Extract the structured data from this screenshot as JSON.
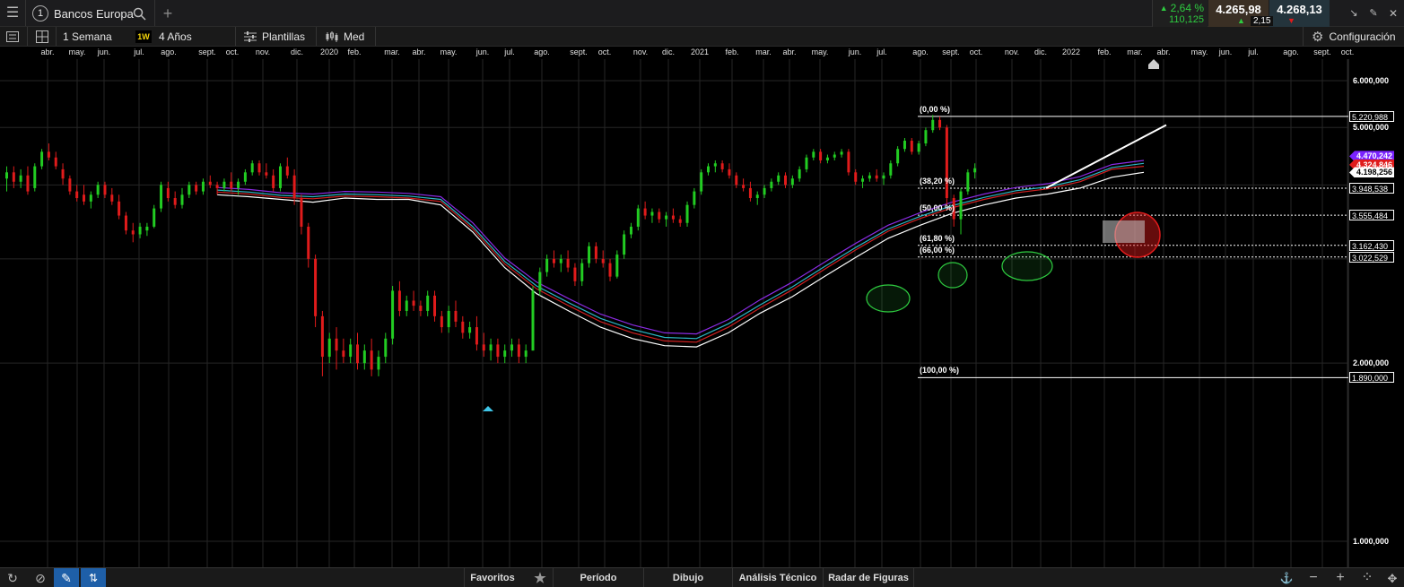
{
  "topbar": {
    "menu_icon": "hamburger-icon",
    "instrument_number": "1",
    "instrument_name": "Bancos Europa",
    "change_pct": "2,64 %",
    "change_abs": "110,125",
    "bid": "4.265,98",
    "bid_change": "2,15",
    "ask": "4.268,13"
  },
  "toolbar": {
    "period": "1 Semana",
    "interval_badge": "1W",
    "range": "4 Años",
    "templates": "Plantillas",
    "price_type": "Med",
    "settings": "Configuración"
  },
  "bottombar": {
    "favorites": "Favoritos",
    "period": "Período",
    "drawing": "Dibujo",
    "technical": "Análisis Técnico",
    "patterns": "Radar de Figuras"
  },
  "colors": {
    "up": "#22cc22",
    "down": "#e01b1b",
    "ema_white": "#ffffff",
    "ema_purple": "#8a2be2",
    "ema_cyan": "#2bb7c4",
    "ema_red": "#d02020",
    "accent_green": "#2ecc40"
  },
  "chart_data": {
    "type": "candlestick",
    "scale": "log",
    "months": [
      {
        "label": "abr."
      },
      {
        "label": "may."
      },
      {
        "label": "jun."
      },
      {
        "label": "jul."
      },
      {
        "label": "ago."
      },
      {
        "label": "sept."
      },
      {
        "label": "oct."
      },
      {
        "label": "nov."
      },
      {
        "label": "dic."
      },
      {
        "label": "2020"
      },
      {
        "label": "feb."
      },
      {
        "label": "mar."
      },
      {
        "label": "abr."
      },
      {
        "label": "may."
      },
      {
        "label": "jun."
      },
      {
        "label": "jul."
      },
      {
        "label": "ago."
      },
      {
        "label": "sept."
      },
      {
        "label": "oct."
      },
      {
        "label": "nov."
      },
      {
        "label": "dic."
      },
      {
        "label": "2021"
      },
      {
        "label": "feb."
      },
      {
        "label": "mar."
      },
      {
        "label": "abr."
      },
      {
        "label": "may."
      },
      {
        "label": "jun."
      },
      {
        "label": "jul."
      },
      {
        "label": "ago."
      },
      {
        "label": "sept."
      },
      {
        "label": "oct."
      },
      {
        "label": "nov."
      },
      {
        "label": "dic."
      },
      {
        "label": "2022"
      },
      {
        "label": "feb."
      },
      {
        "label": "mar."
      },
      {
        "label": "abr."
      },
      {
        "label": "may."
      },
      {
        "label": "jun."
      },
      {
        "label": "jul."
      },
      {
        "label": "ago."
      },
      {
        "label": "sept."
      },
      {
        "label": "oct."
      }
    ],
    "y_axis_labels": [
      {
        "label": "6.000,000",
        "value": 6000
      },
      {
        "label": "5.000,000",
        "value": 5000
      },
      {
        "label": "2.000,000",
        "value": 2000
      },
      {
        "label": "1.000,000",
        "value": 1000
      }
    ],
    "fibonacci": [
      {
        "label": "(0,00 %)",
        "price": "5.220,988",
        "value": 5220.988
      },
      {
        "label": "(38,20 %)",
        "price": "3.948,538",
        "value": 3948.538
      },
      {
        "label": "(50,00 %)",
        "price": "3.555,484",
        "value": 3555.484
      },
      {
        "label": "(61,80 %)",
        "price": "3.162,430",
        "value": 3162.43
      },
      {
        "label": "(66,00 %)",
        "price": "3.022,529",
        "value": 3022.529
      },
      {
        "label": "(100,00 %)",
        "price": "1.890,000",
        "value": 1890
      }
    ],
    "price_tags": [
      {
        "price": "4.470,242",
        "value": 4470.242,
        "color": "#7a22ff",
        "text_color": "#ffffff"
      },
      {
        "price": "4.324,846",
        "value": 4324.846,
        "color": "#e01b1b",
        "text_color": "#ffffff"
      },
      {
        "price": "4.198,256",
        "value": 4198.256,
        "color": "#ffffff",
        "text_color": "#000000"
      }
    ],
    "candles": [
      [
        4100,
        4300,
        3900,
        4200
      ],
      [
        4200,
        4300,
        3950,
        4050
      ],
      [
        4050,
        4250,
        3950,
        4150
      ],
      [
        4150,
        4300,
        3850,
        3900
      ],
      [
        3950,
        4350,
        3900,
        4300
      ],
      [
        4300,
        4600,
        4250,
        4550
      ],
      [
        4550,
        4700,
        4400,
        4450
      ],
      [
        4450,
        4550,
        4250,
        4300
      ],
      [
        4250,
        4350,
        4000,
        4100
      ],
      [
        4100,
        4150,
        3850,
        3900
      ],
      [
        3900,
        4000,
        3750,
        3800
      ],
      [
        3850,
        4000,
        3700,
        3750
      ],
      [
        3750,
        3900,
        3650,
        3850
      ],
      [
        3850,
        4050,
        3800,
        4000
      ],
      [
        4000,
        4050,
        3800,
        3850
      ],
      [
        3850,
        3950,
        3700,
        3750
      ],
      [
        3750,
        3850,
        3500,
        3550
      ],
      [
        3550,
        3600,
        3300,
        3350
      ],
      [
        3350,
        3450,
        3200,
        3300
      ],
      [
        3300,
        3450,
        3250,
        3400
      ],
      [
        3350,
        3450,
        3280,
        3400
      ],
      [
        3400,
        3700,
        3380,
        3650
      ],
      [
        3650,
        4050,
        3600,
        4000
      ],
      [
        3950,
        4050,
        3750,
        3800
      ],
      [
        3800,
        3900,
        3650,
        3700
      ],
      [
        3700,
        3950,
        3650,
        3850
      ],
      [
        3850,
        4050,
        3800,
        4000
      ],
      [
        4000,
        4050,
        3850,
        3900
      ],
      [
        3900,
        4100,
        3850,
        4050
      ],
      [
        4050,
        4150,
        3950,
        4000
      ],
      [
        4000,
        4050,
        3850,
        3950
      ],
      [
        3950,
        4100,
        3900,
        4050
      ],
      [
        4050,
        4200,
        3900,
        3950
      ],
      [
        3950,
        4100,
        3850,
        4050
      ],
      [
        4050,
        4250,
        4000,
        4200
      ],
      [
        4200,
        4400,
        4150,
        4350
      ],
      [
        4350,
        4400,
        4150,
        4200
      ],
      [
        4200,
        4350,
        4100,
        4150
      ],
      [
        4150,
        4250,
        3900,
        3950
      ],
      [
        3950,
        4350,
        3900,
        4300
      ],
      [
        4300,
        4450,
        4100,
        4150
      ],
      [
        4150,
        4250,
        3700,
        3800
      ],
      [
        3800,
        3850,
        3300,
        3400
      ],
      [
        3400,
        3450,
        2900,
        3000
      ],
      [
        3000,
        3050,
        2300,
        2400
      ],
      [
        2400,
        2450,
        1900,
        2050
      ],
      [
        2050,
        2250,
        2000,
        2200
      ],
      [
        2200,
        2300,
        1950,
        2100
      ],
      [
        2100,
        2200,
        2000,
        2050
      ],
      [
        2050,
        2200,
        2000,
        2150
      ],
      [
        2150,
        2250,
        1950,
        2000
      ],
      [
        2000,
        2150,
        1950,
        2100
      ],
      [
        2100,
        2200,
        1900,
        1950
      ],
      [
        1950,
        2100,
        1900,
        2050
      ],
      [
        2050,
        2250,
        2000,
        2200
      ],
      [
        2200,
        2700,
        2150,
        2650
      ],
      [
        2650,
        2750,
        2400,
        2450
      ],
      [
        2450,
        2600,
        2400,
        2550
      ],
      [
        2550,
        2650,
        2450,
        2500
      ],
      [
        2500,
        2550,
        2400,
        2450
      ],
      [
        2450,
        2650,
        2400,
        2600
      ],
      [
        2600,
        2650,
        2350,
        2400
      ],
      [
        2400,
        2450,
        2250,
        2300
      ],
      [
        2300,
        2500,
        2250,
        2450
      ],
      [
        2450,
        2550,
        2300,
        2350
      ],
      [
        2350,
        2400,
        2200,
        2250
      ],
      [
        2250,
        2350,
        2200,
        2300
      ],
      [
        2300,
        2400,
        2100,
        2150
      ],
      [
        2150,
        2250,
        2050,
        2100
      ],
      [
        2100,
        2200,
        2020,
        2150
      ],
      [
        2150,
        2200,
        2000,
        2050
      ],
      [
        2050,
        2150,
        2000,
        2100
      ],
      [
        2100,
        2200,
        2050,
        2150
      ],
      [
        2150,
        2200,
        2000,
        2050
      ],
      [
        2050,
        2150,
        2000,
        2100
      ],
      [
        2100,
        2700,
        2100,
        2650
      ],
      [
        2650,
        2900,
        2600,
        2850
      ],
      [
        2850,
        3050,
        2800,
        3000
      ],
      [
        3000,
        3100,
        2900,
        2950
      ],
      [
        2950,
        3050,
        2850,
        3000
      ],
      [
        3000,
        3100,
        2850,
        2900
      ],
      [
        2900,
        2950,
        2700,
        2750
      ],
      [
        2750,
        3000,
        2700,
        2950
      ],
      [
        2950,
        3200,
        2900,
        3150
      ],
      [
        3150,
        3200,
        2950,
        3000
      ],
      [
        3000,
        3100,
        2900,
        2950
      ],
      [
        2950,
        3000,
        2750,
        2800
      ],
      [
        2800,
        3100,
        2780,
        3050
      ],
      [
        3050,
        3350,
        3000,
        3300
      ],
      [
        3300,
        3450,
        3250,
        3400
      ],
      [
        3400,
        3700,
        3350,
        3650
      ],
      [
        3650,
        3750,
        3500,
        3550
      ],
      [
        3550,
        3650,
        3450,
        3600
      ],
      [
        3600,
        3650,
        3450,
        3500
      ],
      [
        3500,
        3600,
        3400,
        3550
      ],
      [
        3550,
        3650,
        3450,
        3500
      ],
      [
        3500,
        3550,
        3400,
        3450
      ],
      [
        3450,
        3750,
        3400,
        3700
      ],
      [
        3700,
        3950,
        3650,
        3900
      ],
      [
        3900,
        4250,
        3850,
        4200
      ],
      [
        4200,
        4350,
        4150,
        4300
      ],
      [
        4300,
        4400,
        4200,
        4350
      ],
      [
        4350,
        4400,
        4200,
        4250
      ],
      [
        4250,
        4350,
        4100,
        4150
      ],
      [
        4150,
        4200,
        3950,
        4000
      ],
      [
        4000,
        4100,
        3900,
        3950
      ],
      [
        3950,
        4050,
        3750,
        3800
      ],
      [
        3800,
        3900,
        3700,
        3850
      ],
      [
        3850,
        4000,
        3800,
        3950
      ],
      [
        3950,
        4100,
        3900,
        4050
      ],
      [
        4050,
        4200,
        4000,
        4150
      ],
      [
        4150,
        4200,
        3950,
        4000
      ],
      [
        4000,
        4150,
        3950,
        4100
      ],
      [
        4100,
        4300,
        4050,
        4250
      ],
      [
        4250,
        4500,
        4200,
        4450
      ],
      [
        4450,
        4600,
        4400,
        4550
      ],
      [
        4550,
        4600,
        4350,
        4400
      ],
      [
        4400,
        4500,
        4350,
        4450
      ],
      [
        4450,
        4550,
        4400,
        4500
      ],
      [
        4500,
        4600,
        4450,
        4550
      ],
      [
        4550,
        4600,
        4150,
        4200
      ],
      [
        4200,
        4250,
        4000,
        4050
      ],
      [
        4050,
        4150,
        3950,
        4100
      ],
      [
        4100,
        4200,
        4050,
        4150
      ],
      [
        4150,
        4250,
        4050,
        4100
      ],
      [
        4100,
        4200,
        4000,
        4150
      ],
      [
        4150,
        4400,
        4100,
        4350
      ],
      [
        4350,
        4650,
        4300,
        4600
      ],
      [
        4600,
        4800,
        4550,
        4750
      ],
      [
        4750,
        4800,
        4500,
        4550
      ],
      [
        4550,
        4750,
        4500,
        4700
      ],
      [
        4700,
        5000,
        4650,
        4950
      ],
      [
        4950,
        5250,
        4900,
        5150
      ],
      [
        5150,
        5221,
        4950,
        5000
      ],
      [
        5000,
        5050,
        3700,
        3800
      ],
      [
        3800,
        3850,
        3400,
        3500
      ],
      [
        3500,
        3950,
        3300,
        3900
      ],
      [
        3900,
        4250,
        3850,
        4200
      ],
      [
        4200,
        4350,
        4100,
        4268
      ]
    ],
    "ema": {
      "white": [
        3850,
        3820,
        3780,
        3740,
        3800,
        3780,
        3780,
        3700,
        3330,
        2900,
        2620,
        2450,
        2300,
        2200,
        2140,
        2130,
        2250,
        2430,
        2590,
        2800,
        3020,
        3250,
        3420,
        3580,
        3700,
        3800,
        3860,
        3950,
        4120,
        4200
      ],
      "purple": [
        3960,
        3930,
        3880,
        3860,
        3900,
        3890,
        3870,
        3820,
        3450,
        3010,
        2740,
        2570,
        2420,
        2320,
        2250,
        2240,
        2370,
        2560,
        2740,
        2960,
        3190,
        3420,
        3590,
        3740,
        3860,
        3960,
        4020,
        4130,
        4330,
        4400
      ],
      "cyan": [
        3920,
        3890,
        3840,
        3820,
        3860,
        3850,
        3830,
        3780,
        3400,
        2970,
        2700,
        2530,
        2380,
        2280,
        2210,
        2200,
        2330,
        2510,
        2690,
        2910,
        3140,
        3370,
        3540,
        3690,
        3810,
        3910,
        3970,
        4080,
        4280,
        4350
      ],
      "red": [
        3890,
        3860,
        3810,
        3790,
        3830,
        3820,
        3800,
        3750,
        3370,
        2940,
        2670,
        2500,
        2350,
        2250,
        2180,
        2170,
        2300,
        2480,
        2660,
        2880,
        3110,
        3340,
        3510,
        3660,
        3780,
        3880,
        3940,
        4050,
        4250,
        4300
      ]
    },
    "trendline": {
      "from": 3950,
      "to": 5050
    }
  }
}
